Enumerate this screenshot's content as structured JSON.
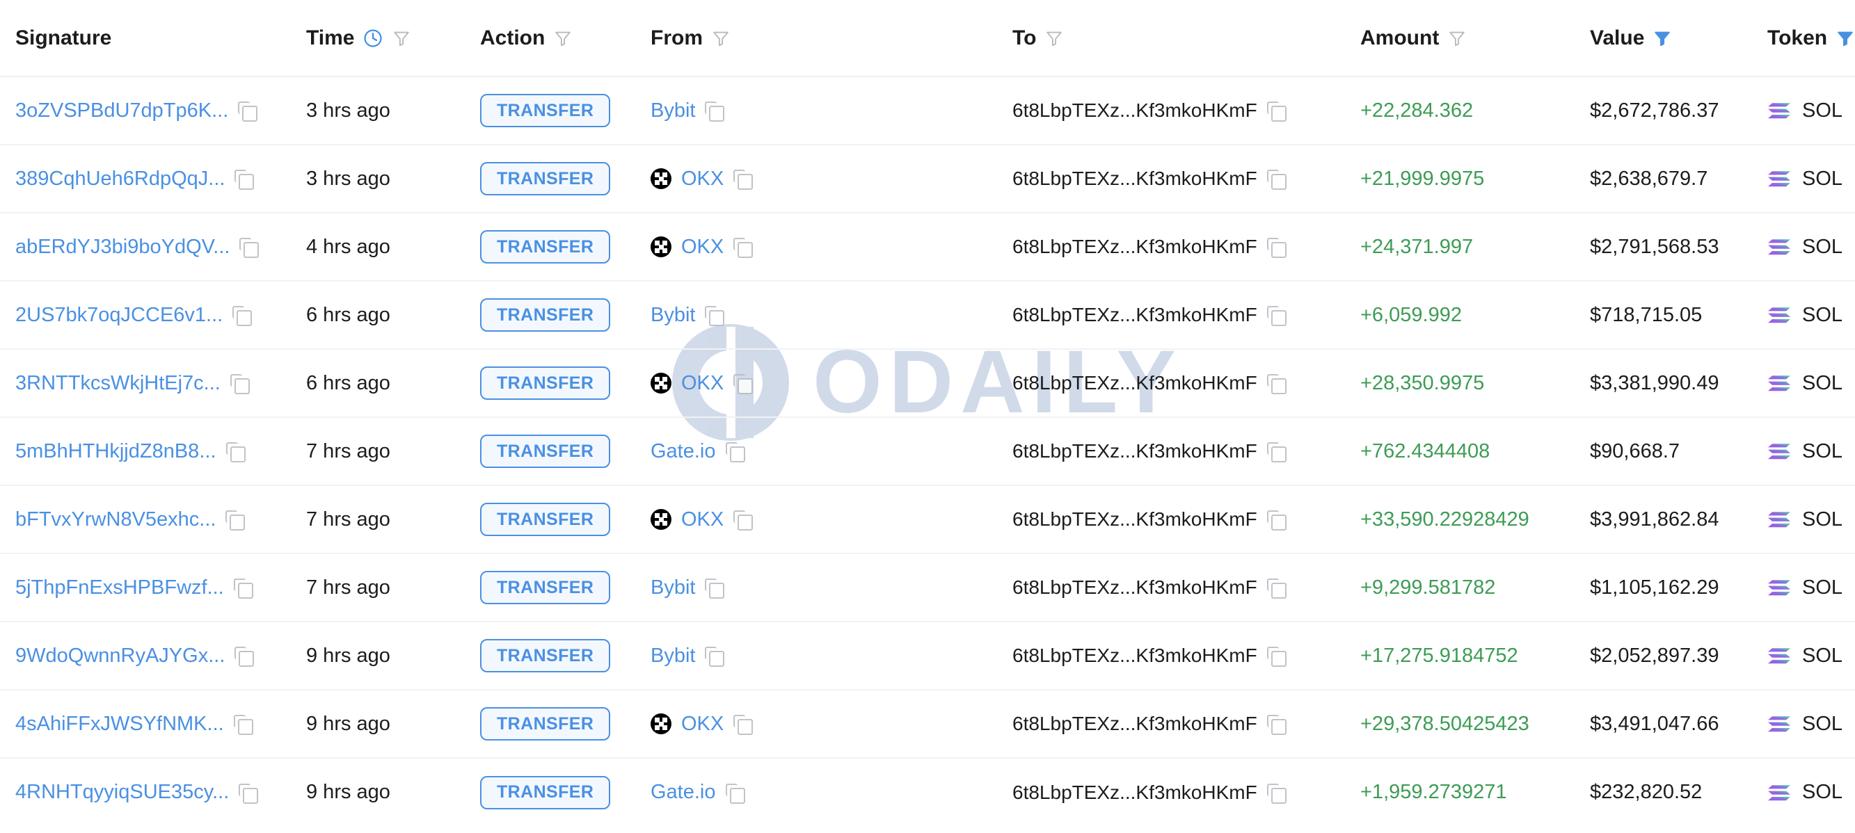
{
  "table": {
    "columns": [
      {
        "key": "signature",
        "label": "Signature",
        "filter": "none",
        "clock": false
      },
      {
        "key": "time",
        "label": "Time",
        "filter": "outline",
        "clock": true
      },
      {
        "key": "action",
        "label": "Action",
        "filter": "outline",
        "clock": false
      },
      {
        "key": "from",
        "label": "From",
        "filter": "outline",
        "clock": false
      },
      {
        "key": "to",
        "label": "To",
        "filter": "outline",
        "clock": false
      },
      {
        "key": "amount",
        "label": "Amount",
        "filter": "outline",
        "clock": false
      },
      {
        "key": "value",
        "label": "Value",
        "filter": "active",
        "clock": false
      },
      {
        "key": "token",
        "label": "Token",
        "filter": "active",
        "clock": false
      }
    ],
    "rows": [
      {
        "signature": "3oZVSPBdU7dpTp6K...",
        "time": "3 hrs ago",
        "action": "TRANSFER",
        "from": "Bybit",
        "from_icon": "none",
        "to": "6t8LbpTEXz...Kf3mkoHKmF",
        "amount": "+22,284.362",
        "value": "$2,672,786.37",
        "token": "SOL"
      },
      {
        "signature": "389CqhUeh6RdpQqJ...",
        "time": "3 hrs ago",
        "action": "TRANSFER",
        "from": "OKX",
        "from_icon": "okx",
        "to": "6t8LbpTEXz...Kf3mkoHKmF",
        "amount": "+21,999.9975",
        "value": "$2,638,679.7",
        "token": "SOL"
      },
      {
        "signature": "abERdYJ3bi9boYdQV...",
        "time": "4 hrs ago",
        "action": "TRANSFER",
        "from": "OKX",
        "from_icon": "okx",
        "to": "6t8LbpTEXz...Kf3mkoHKmF",
        "amount": "+24,371.997",
        "value": "$2,791,568.53",
        "token": "SOL"
      },
      {
        "signature": "2US7bk7oqJCCE6v1...",
        "time": "6 hrs ago",
        "action": "TRANSFER",
        "from": "Bybit",
        "from_icon": "none",
        "to": "6t8LbpTEXz...Kf3mkoHKmF",
        "amount": "+6,059.992",
        "value": "$718,715.05",
        "token": "SOL"
      },
      {
        "signature": "3RNTTkcsWkjHtEj7c...",
        "time": "6 hrs ago",
        "action": "TRANSFER",
        "from": "OKX",
        "from_icon": "okx",
        "to": "6t8LbpTEXz...Kf3mkoHKmF",
        "amount": "+28,350.9975",
        "value": "$3,381,990.49",
        "token": "SOL"
      },
      {
        "signature": "5mBhHTHkjjdZ8nB8...",
        "time": "7 hrs ago",
        "action": "TRANSFER",
        "from": "Gate.io",
        "from_icon": "none",
        "to": "6t8LbpTEXz...Kf3mkoHKmF",
        "amount": "+762.4344408",
        "value": "$90,668.7",
        "token": "SOL"
      },
      {
        "signature": "bFTvxYrwN8V5exhc...",
        "time": "7 hrs ago",
        "action": "TRANSFER",
        "from": "OKX",
        "from_icon": "okx",
        "to": "6t8LbpTEXz...Kf3mkoHKmF",
        "amount": "+33,590.22928429",
        "value": "$3,991,862.84",
        "token": "SOL"
      },
      {
        "signature": "5jThpFnExsHPBFwzf...",
        "time": "7 hrs ago",
        "action": "TRANSFER",
        "from": "Bybit",
        "from_icon": "none",
        "to": "6t8LbpTEXz...Kf3mkoHKmF",
        "amount": "+9,299.581782",
        "value": "$1,105,162.29",
        "token": "SOL"
      },
      {
        "signature": "9WdoQwnnRyAJYGx...",
        "time": "9 hrs ago",
        "action": "TRANSFER",
        "from": "Bybit",
        "from_icon": "none",
        "to": "6t8LbpTEXz...Kf3mkoHKmF",
        "amount": "+17,275.9184752",
        "value": "$2,052,897.39",
        "token": "SOL"
      },
      {
        "signature": "4sAhiFFxJWSYfNMK...",
        "time": "9 hrs ago",
        "action": "TRANSFER",
        "from": "OKX",
        "from_icon": "okx",
        "to": "6t8LbpTEXz...Kf3mkoHKmF",
        "amount": "+29,378.50425423",
        "value": "$3,491,047.66",
        "token": "SOL"
      },
      {
        "signature": "4RNHTqyyiqSUE35cy...",
        "time": "9 hrs ago",
        "action": "TRANSFER",
        "from": "Gate.io",
        "from_icon": "none",
        "to": "6t8LbpTEXz...Kf3mkoHKmF",
        "amount": "+1,959.2739271",
        "value": "$232,820.52",
        "token": "SOL"
      }
    ]
  },
  "watermark": {
    "text": "ODAILY"
  },
  "colors": {
    "link": "#4a90e2",
    "amount_positive": "#3d9c55",
    "filter_active": "#4a90e2",
    "filter_inactive": "#b6babf",
    "pill_border": "#4a90e2",
    "pill_bg": "#f3f8fe",
    "row_divider": "#f1f2f4",
    "watermark": "#93a9cd",
    "sol_gradient_start": "#4ade9f",
    "sol_gradient_end": "#b14fe8"
  }
}
